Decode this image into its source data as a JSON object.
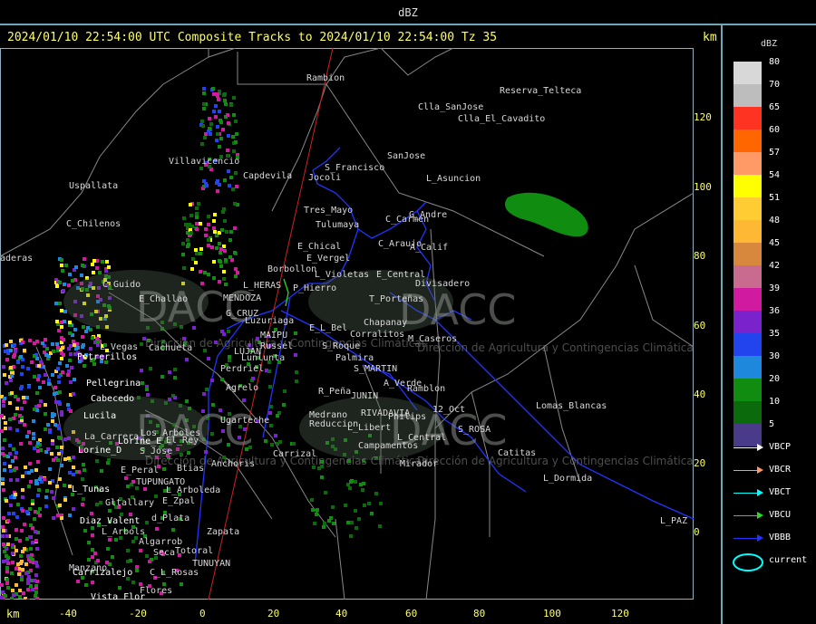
{
  "title_bar": {
    "text": "dBZ"
  },
  "header": {
    "text": "2024/01/10 22:54:00 UTC Composite Tracks to 2024/01/10 22:54:00 Tz 35",
    "km": "km"
  },
  "axes": {
    "x_unit": "km",
    "x_ticks": [
      "-40",
      "-20",
      "0",
      "20",
      "40",
      "60",
      "80",
      "100",
      "120"
    ],
    "y_ticks": [
      "120",
      "100",
      "80",
      "60",
      "40",
      "20",
      "0"
    ]
  },
  "map_labels": [
    "Rambion",
    "Reserva_Telteca",
    "Clla_SanJose",
    "Clla_El_Cavadito",
    "Uspallata",
    "Villavicencio",
    "Capdevila",
    "S_Francisco",
    "Jocoli",
    "SanJose",
    "L_Asuncion",
    "Tres_Mayo",
    "Tulumaya",
    "C_Carmen",
    "G_Andre",
    "C_Chilenos",
    "E_Chical",
    "C_Araujo",
    "A_Calif",
    "E_Vergel",
    "Borbollon",
    "L_Violetas",
    "E_Central",
    "Divisadero",
    "C_Guido",
    "E_Challao",
    "MENDOZA",
    "L_HERAS",
    "P_Hierro",
    "T_Porteñas",
    "G_CRUZ",
    "Luzuriaga",
    "Chapanay",
    "E_L_Bel",
    "MAIPU",
    "Corralitos",
    "Cachueta",
    "L_Vegas",
    "Russel",
    "S_Roque",
    "Palmira",
    "M_Caseros",
    "Potrerillos",
    "Lunlunta",
    "LUJAN",
    "Perdriel",
    "S_MARTIN",
    "A_Verde",
    "Ramblon",
    "Pellegrina",
    "Agrelo",
    "R_Peña",
    "JUNIN",
    "Lomas_Blancas",
    "Cabecedo",
    "Lucila",
    "Ugarteche",
    "Medrano",
    "Reduccion",
    "RIVADAVIA",
    "Philips",
    "12_Oct",
    "S_ROSA",
    "La_Carrera",
    "Lorine_D",
    "Lorine_E",
    "S_Jose",
    "Los_Arboles",
    "El_Rey",
    "Carrizal",
    "L_Libert",
    "L_Central",
    "Campamentos",
    "Catitas",
    "E_Peral",
    "Btias",
    "Anchoris",
    "Mirador",
    "L_Dormida",
    "TUPUNGATO",
    "L_Tunas",
    "Gltallary",
    "E_Zpal",
    "L_Arboleda",
    "Diaz_Valent",
    "d_Plata",
    "L_Arbols",
    "Zapata",
    "L_PAZ",
    "Algarrob",
    "Seca",
    "Totoral",
    "Manzano",
    "Carrizalejo",
    "C_L_Rosas",
    "TUNUYAN",
    "Vista_Flor",
    "Flores",
    "aderas"
  ],
  "watermark": {
    "logo_text": "DACC",
    "subtitle": "Dirección de Agricultura y Contingencias Climáticas"
  },
  "legend": {
    "title": "dBZ",
    "scale": [
      {
        "value": "80",
        "color": "#d8d8d8"
      },
      {
        "value": "70",
        "color": "#bdbdbd"
      },
      {
        "value": "65",
        "color": "#ff3322"
      },
      {
        "value": "60",
        "color": "#ff6600"
      },
      {
        "value": "57",
        "color": "#ff9966"
      },
      {
        "value": "54",
        "color": "#ffff00"
      },
      {
        "value": "51",
        "color": "#ffcc33"
      },
      {
        "value": "48",
        "color": "#ffb833"
      },
      {
        "value": "45",
        "color": "#d8883c"
      },
      {
        "value": "42",
        "color": "#c86b8e"
      },
      {
        "value": "39",
        "color": "#d01aa0"
      },
      {
        "value": "36",
        "color": "#7a22cc"
      },
      {
        "value": "35",
        "color": "#2244ee"
      },
      {
        "value": "30",
        "color": "#1e88dd"
      },
      {
        "value": "20",
        "color": "#108c10"
      },
      {
        "value": "10",
        "color": "#0b6a0b"
      },
      {
        "value": "5",
        "color": "#4a3a8a"
      }
    ],
    "tracks": [
      {
        "label": "VBCP",
        "color": "#ffffff"
      },
      {
        "label": "VBCR",
        "color": "#ff9966"
      },
      {
        "label": "VBCT",
        "color": "#00ffff"
      },
      {
        "label": "VBCU",
        "color": "#22dd22"
      },
      {
        "label": "VBBB",
        "color": "#2233ff"
      }
    ],
    "current_label": "current",
    "current_color": "#00ffff"
  },
  "colors": {
    "frame": "#6fa7b8",
    "axis_text": "#ffff66",
    "border_lines": "#888888",
    "river_lines": "#2233ff",
    "cell_green": "#108c10"
  }
}
